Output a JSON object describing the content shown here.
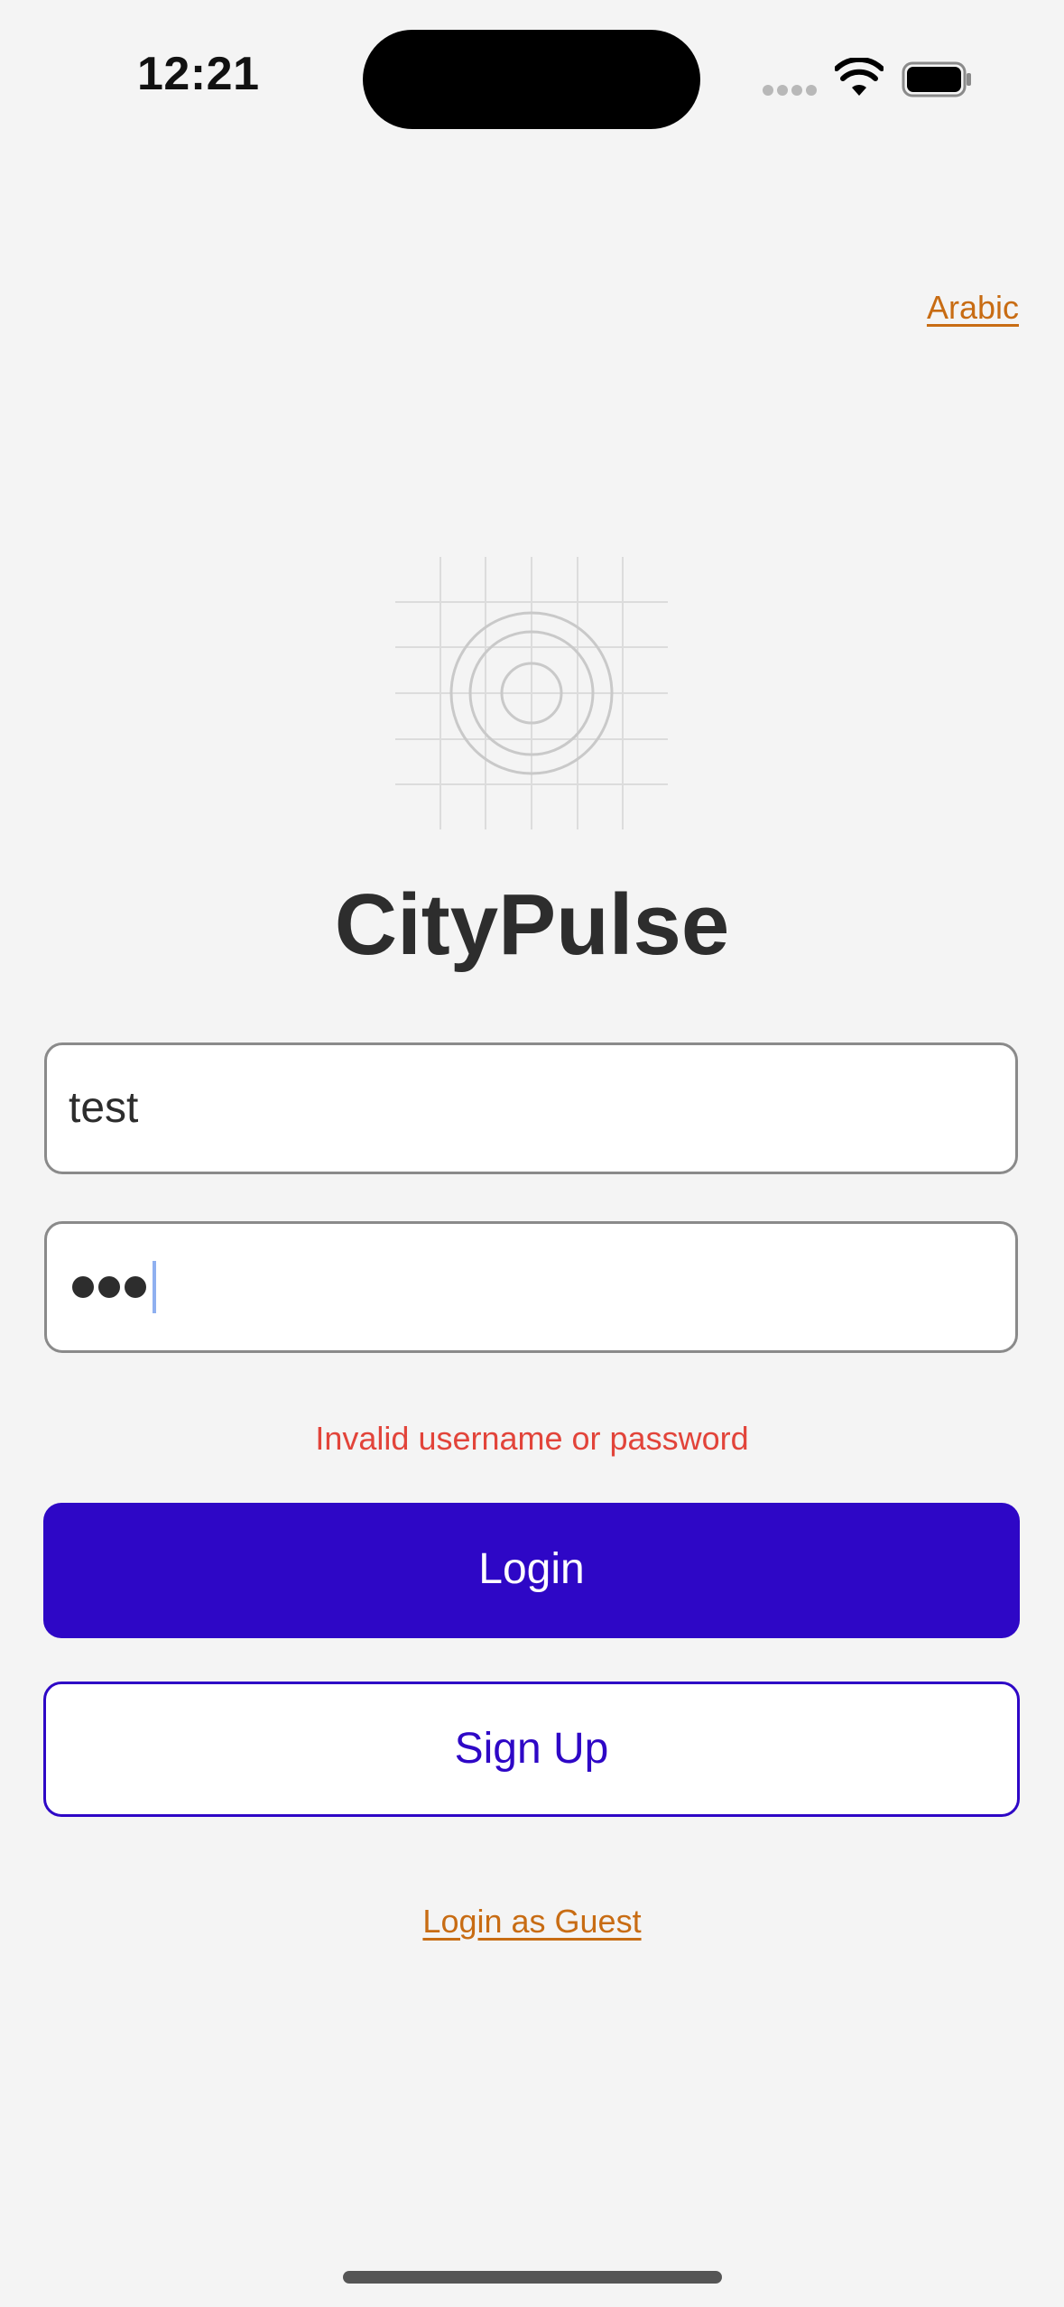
{
  "status_bar": {
    "time": "12:21",
    "icons": [
      "cellular-signal-icon",
      "wifi-icon",
      "battery-icon"
    ]
  },
  "header": {
    "language_link": "Arabic"
  },
  "branding": {
    "logo_icon": "image-placeholder-icon",
    "app_name": "CityPulse"
  },
  "form": {
    "username_value": "test",
    "password_masked_length": 3,
    "error_message": "Invalid username or password"
  },
  "actions": {
    "login_label": "Login",
    "signup_label": "Sign Up",
    "guest_label": "Login as Guest"
  },
  "colors": {
    "primary": "#2e07c6",
    "link": "#c86c13",
    "error": "#e2443a",
    "background": "#f4f4f4"
  }
}
